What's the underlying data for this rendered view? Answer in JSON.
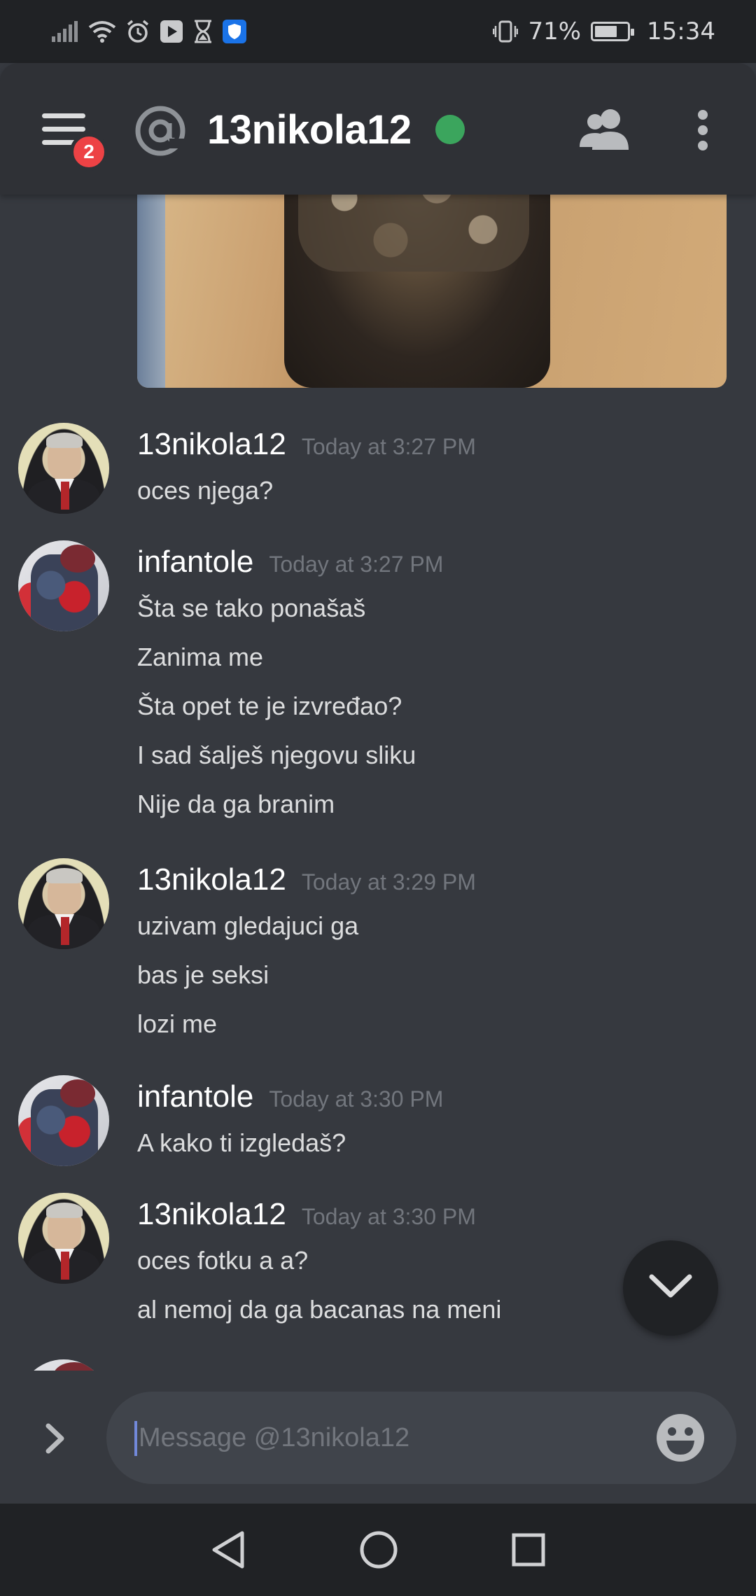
{
  "status_bar": {
    "battery_text": "71%",
    "battery_level": 0.71,
    "time": "15:34"
  },
  "header": {
    "title": "13nikola12",
    "menu_badge_count": "2",
    "online_color": "#3ba55d"
  },
  "messages": [
    {
      "username": "13nikola12",
      "timestamp": "Today at 3:27 PM",
      "avatar": "milosevic-portrait",
      "lines": [
        "oces njega?"
      ]
    },
    {
      "username": "infantole",
      "timestamp": "Today at 3:27 PM",
      "avatar": "jacket-photo",
      "lines": [
        "Šta se tako ponašaš",
        "Zanima me",
        "Šta opet te je izvređao?",
        "I sad šalješ njegovu sliku",
        "Nije da ga branim"
      ]
    },
    {
      "username": "13nikola12",
      "timestamp": "Today at 3:29 PM",
      "avatar": "milosevic-portrait",
      "lines": [
        "uzivam gledajuci ga",
        "bas je seksi",
        "lozi me"
      ]
    },
    {
      "username": "infantole",
      "timestamp": "Today at 3:30 PM",
      "avatar": "jacket-photo",
      "lines": [
        "A kako ti izgledaš?"
      ]
    },
    {
      "username": "13nikola12",
      "timestamp": "Today at 3:30 PM",
      "avatar": "milosevic-portrait",
      "lines": [
        "oces fotku a a?",
        "al nemoj da ga bacanas na meni"
      ]
    }
  ],
  "input": {
    "placeholder": "Message @13nikola12",
    "value": ""
  },
  "colors": {
    "background": "#36393f",
    "header": "#2f3136",
    "badge": "#ed4245",
    "accent": "#7289da"
  }
}
